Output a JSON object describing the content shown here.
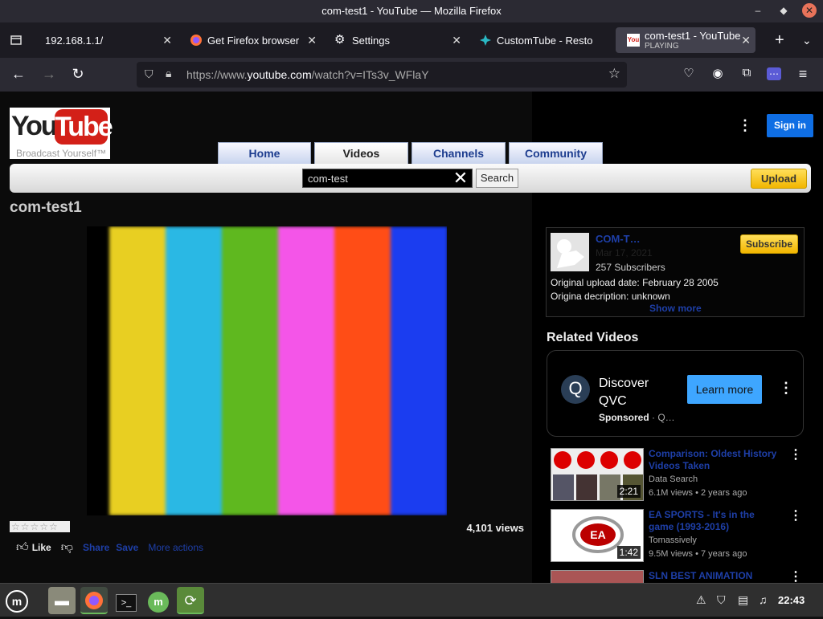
{
  "window": {
    "title": "com-test1 - YouTube — Mozilla Firefox"
  },
  "tabs": [
    {
      "label": "192.168.1.1/",
      "favicon": "none"
    },
    {
      "label": "Get Firefox browser",
      "favicon": "firefox-icon"
    },
    {
      "label": "Settings",
      "favicon": "gear-icon"
    },
    {
      "label": "CustomTube - Resto",
      "favicon": "customtube-icon"
    },
    {
      "label": "com-test1 - YouTube",
      "sub": "PLAYING",
      "favicon": "youtube-icon"
    }
  ],
  "urlbar": {
    "prefix": "https://www.",
    "host": "youtube.com",
    "path": "/watch?v=ITs3v_WFlaY"
  },
  "youtube": {
    "logo_you": "You",
    "logo_tube": "Tube",
    "logo_tagline": "Broadcast Yourself™",
    "nav": [
      "Home",
      "Videos",
      "Channels",
      "Community"
    ],
    "search_value": "com-test",
    "search_button": "Search",
    "upload_button": "Upload",
    "signin_button": "Sign in",
    "video_title": "com-test1",
    "rating_stars": "☆☆☆☆☆",
    "views": "4,101 views",
    "like_label": "Like",
    "share_label": "Share",
    "save_label": "Save",
    "more_actions_label": "More actions"
  },
  "channel": {
    "name": "COM-T…",
    "date": "Mar 17, 2021",
    "subscribers": "257 Subscribers",
    "upload_date": "Original upload date: February 28 2005",
    "description": "Origina decription: unknown",
    "show_more": "Show more",
    "subscribe_button": "Subscribe"
  },
  "related": {
    "heading": "Related Videos",
    "ad": {
      "title": "Discover QVC",
      "sponsored": "Sponsored",
      "advertiser": "Q…",
      "button": "Learn more"
    },
    "items": [
      {
        "title": "Comparison: Oldest History Videos Taken",
        "channel": "Data Search",
        "meta": "6.1M views  • 2 years ago",
        "duration": "2:21"
      },
      {
        "title": "EA SPORTS - It's in the game (1993-2016)",
        "channel": "Tomassively",
        "meta": "9.5M views  • 7 years ago",
        "duration": "1:42"
      },
      {
        "title": "SLN BEST ANIMATION",
        "channel": "",
        "meta": "",
        "duration": ""
      }
    ]
  },
  "taskbar": {
    "clock": "22:43"
  },
  "colors": {
    "bars": [
      "#e8cf22",
      "#2ab8e4",
      "#5fb81f",
      "#f455e8",
      "#ff4d16",
      "#1b3df0"
    ]
  }
}
